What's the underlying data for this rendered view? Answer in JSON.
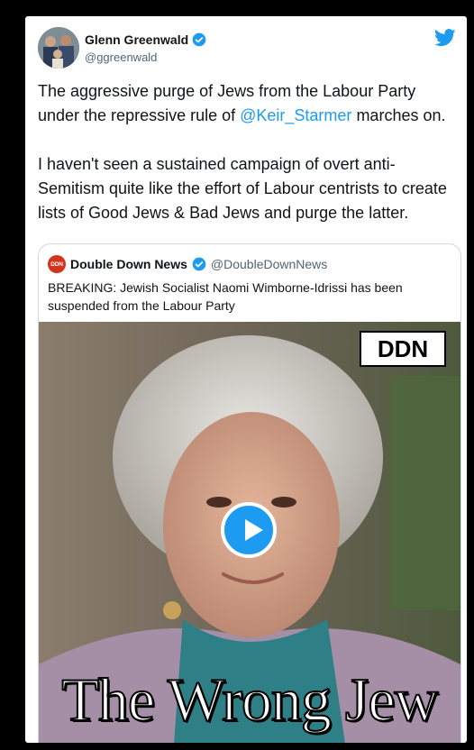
{
  "tweet": {
    "author_name": "Glenn Greenwald",
    "author_handle": "@ggreenwald",
    "text_line1_pre": "The aggressive purge of Jews from the Labour Party under the repressive rule of ",
    "mention": "@Keir_Starmer",
    "text_line1_post": " marches on.",
    "text_para2": "I haven't seen a sustained campaign of overt anti-Semitism quite like the effort of Labour centrists to create lists of Good Jews & Bad Jews and purge the latter."
  },
  "quoted_tweet": {
    "logo_text": "DDN",
    "author_name": "Double Down News",
    "author_handle": "@DoubleDownNews",
    "text": "BREAKING: Jewish Socialist Naomi Wimborne-Idrissi has been suspended from the Labour Party"
  },
  "media": {
    "badge": "DDN",
    "caption": "The Wrong Jew"
  },
  "colors": {
    "accent": "#1d9bf0",
    "text": "#0f1419",
    "secondary": "#536471"
  },
  "icons": [
    "verified-icon",
    "twitter-bird-icon",
    "play-icon"
  ]
}
